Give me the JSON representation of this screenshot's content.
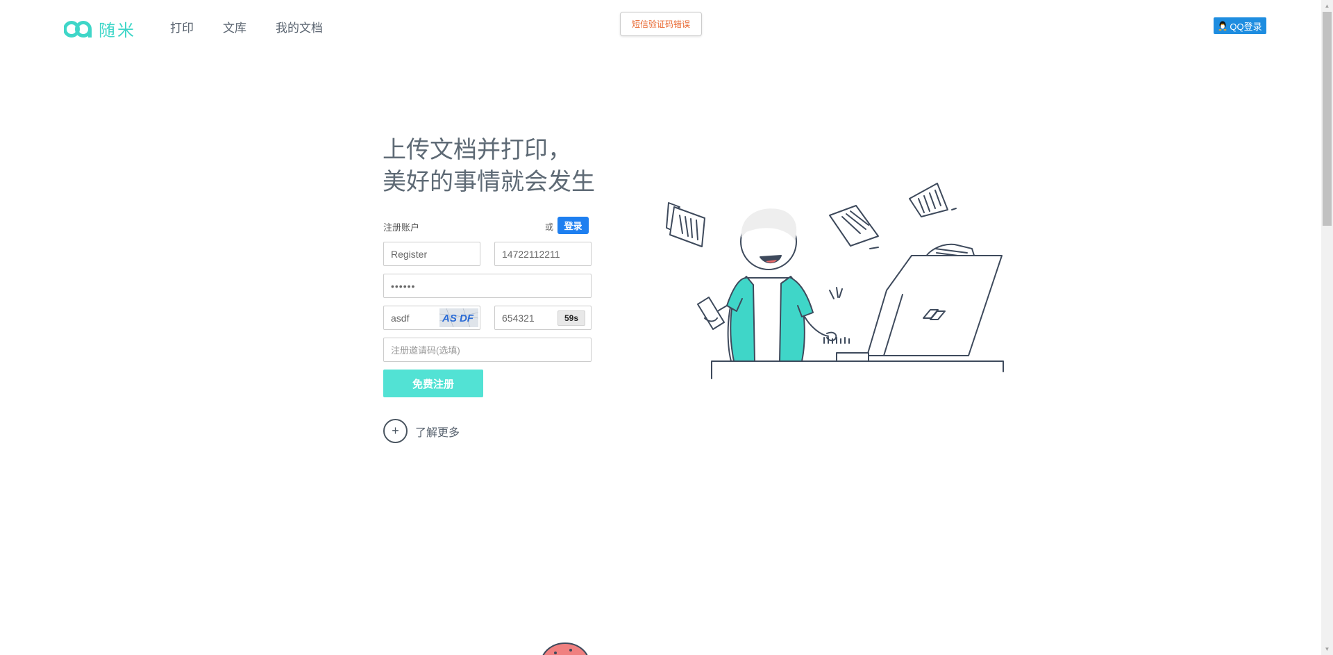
{
  "header": {
    "logo_text": "随米",
    "nav": [
      {
        "label": "打印"
      },
      {
        "label": "文库"
      },
      {
        "label": "我的文档"
      }
    ],
    "toast": "短信验证码错误",
    "qq_login": "QQ登录"
  },
  "hero": {
    "headline_line1": "上传文档并打印，",
    "headline_line2": "美好的事情就会发生"
  },
  "form": {
    "title": "注册账户",
    "or": "或",
    "login_label": "登录",
    "username": "Register",
    "phone": "14722112211",
    "password": "••••••",
    "captcha_value": "asdf",
    "captcha_image_text": "AS DF",
    "sms_code": "654321",
    "sms_countdown": "59s",
    "invite_placeholder": "注册邀请码(选填)",
    "submit_label": "免费注册"
  },
  "learn_more": {
    "icon": "+",
    "label": "了解更多"
  },
  "colors": {
    "brand": "#3fd6c8",
    "submit": "#52e2d4",
    "login": "#1e7ff0",
    "qq": "#1e8de0",
    "toast_text": "#e8662e"
  }
}
